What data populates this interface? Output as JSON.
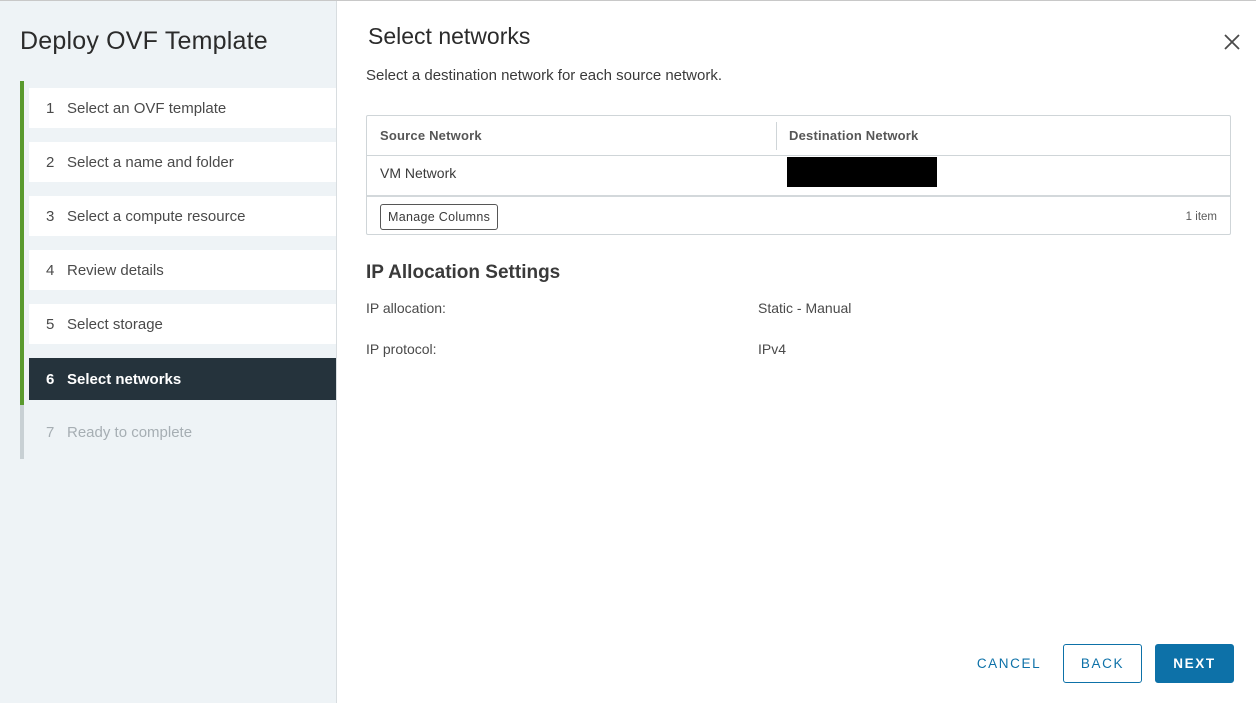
{
  "wizard": {
    "title": "Deploy OVF Template",
    "steps": [
      {
        "num": "1",
        "label": "Select an OVF template"
      },
      {
        "num": "2",
        "label": "Select a name and folder"
      },
      {
        "num": "3",
        "label": "Select a compute resource"
      },
      {
        "num": "4",
        "label": "Review details"
      },
      {
        "num": "5",
        "label": "Select storage"
      },
      {
        "num": "6",
        "label": "Select networks"
      },
      {
        "num": "7",
        "label": "Ready to complete"
      }
    ],
    "active_step": "6"
  },
  "page": {
    "title": "Select networks",
    "subtitle": "Select a destination network for each source network."
  },
  "network_table": {
    "columns": [
      "Source Network",
      "Destination Network"
    ],
    "rows": [
      {
        "source": "VM Network",
        "destination": ""
      }
    ],
    "manage_columns_label": "Manage Columns",
    "item_count": "1 item"
  },
  "ip_settings": {
    "title": "IP Allocation Settings",
    "allocation_label": "IP allocation:",
    "allocation_value": "Static - Manual",
    "protocol_label": "IP protocol:",
    "protocol_value": "IPv4"
  },
  "footer": {
    "cancel_label": "CANCEL",
    "back_label": "BACK",
    "next_label": "NEXT"
  },
  "icons": {
    "close": "close-icon"
  },
  "colors": {
    "primary": "#0d71a8",
    "step_complete": "#5a9a2e",
    "step_active_bg": "#25333c",
    "sidebar_bg": "#eef3f6"
  }
}
